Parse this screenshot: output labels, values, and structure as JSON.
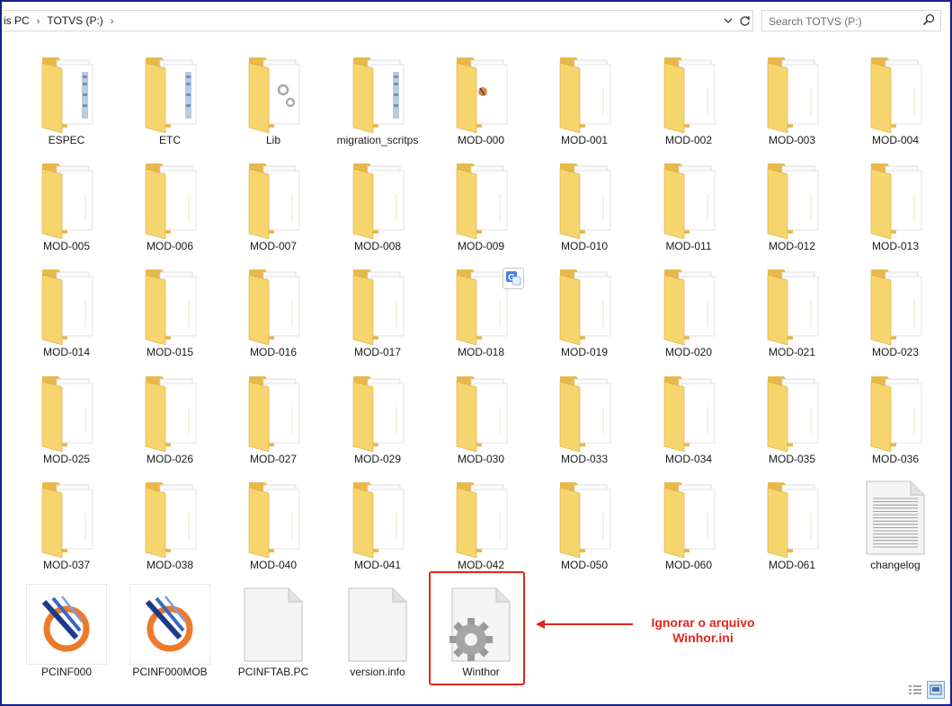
{
  "address": {
    "crumbs": [
      "is PC",
      "TOTVS (P:)"
    ],
    "search_placeholder": "Search TOTVS (P:)"
  },
  "items": [
    {
      "label": "ESPEC",
      "type": "folder-docs"
    },
    {
      "label": "ETC",
      "type": "folder-docs"
    },
    {
      "label": "Lib",
      "type": "folder-gear"
    },
    {
      "label": "migration_scritps",
      "type": "folder-docs"
    },
    {
      "label": "MOD-000",
      "type": "folder-app"
    },
    {
      "label": "MOD-001",
      "type": "folder"
    },
    {
      "label": "MOD-002",
      "type": "folder"
    },
    {
      "label": "MOD-003",
      "type": "folder"
    },
    {
      "label": "MOD-004",
      "type": "folder"
    },
    {
      "label": "MOD-005",
      "type": "folder"
    },
    {
      "label": "MOD-006",
      "type": "folder"
    },
    {
      "label": "MOD-007",
      "type": "folder"
    },
    {
      "label": "MOD-008",
      "type": "folder"
    },
    {
      "label": "MOD-009",
      "type": "folder"
    },
    {
      "label": "MOD-010",
      "type": "folder"
    },
    {
      "label": "MOD-011",
      "type": "folder"
    },
    {
      "label": "MOD-012",
      "type": "folder"
    },
    {
      "label": "MOD-013",
      "type": "folder"
    },
    {
      "label": "MOD-014",
      "type": "folder"
    },
    {
      "label": "MOD-015",
      "type": "folder"
    },
    {
      "label": "MOD-016",
      "type": "folder"
    },
    {
      "label": "MOD-017",
      "type": "folder"
    },
    {
      "label": "MOD-018",
      "type": "folder"
    },
    {
      "label": "MOD-019",
      "type": "folder"
    },
    {
      "label": "MOD-020",
      "type": "folder"
    },
    {
      "label": "MOD-021",
      "type": "folder"
    },
    {
      "label": "MOD-023",
      "type": "folder"
    },
    {
      "label": "MOD-025",
      "type": "folder"
    },
    {
      "label": "MOD-026",
      "type": "folder"
    },
    {
      "label": "MOD-027",
      "type": "folder"
    },
    {
      "label": "MOD-029",
      "type": "folder"
    },
    {
      "label": "MOD-030",
      "type": "folder"
    },
    {
      "label": "MOD-033",
      "type": "folder"
    },
    {
      "label": "MOD-034",
      "type": "folder"
    },
    {
      "label": "MOD-035",
      "type": "folder"
    },
    {
      "label": "MOD-036",
      "type": "folder"
    },
    {
      "label": "MOD-037",
      "type": "folder"
    },
    {
      "label": "MOD-038",
      "type": "folder"
    },
    {
      "label": "MOD-040",
      "type": "folder"
    },
    {
      "label": "MOD-041",
      "type": "folder"
    },
    {
      "label": "MOD-042",
      "type": "folder"
    },
    {
      "label": "MOD-050",
      "type": "folder"
    },
    {
      "label": "MOD-060",
      "type": "folder"
    },
    {
      "label": "MOD-061",
      "type": "folder"
    },
    {
      "label": "changelog",
      "type": "text-file"
    },
    {
      "label": "PCINF000",
      "type": "app-logo"
    },
    {
      "label": "PCINF000MOB",
      "type": "app-logo"
    },
    {
      "label": "PCINFTAB.PC",
      "type": "blank-file"
    },
    {
      "label": "version.info",
      "type": "blank-file"
    },
    {
      "label": "Winthor",
      "type": "settings-file"
    }
  ],
  "annotation": {
    "line1": "Ignorar o arquivo",
    "line2": "Winhor.ini",
    "color": "#e0261c"
  },
  "colors": {
    "folder_back": "#e8b84a",
    "folder_front": "#f7d56e",
    "frame": "#1a1f8c"
  }
}
